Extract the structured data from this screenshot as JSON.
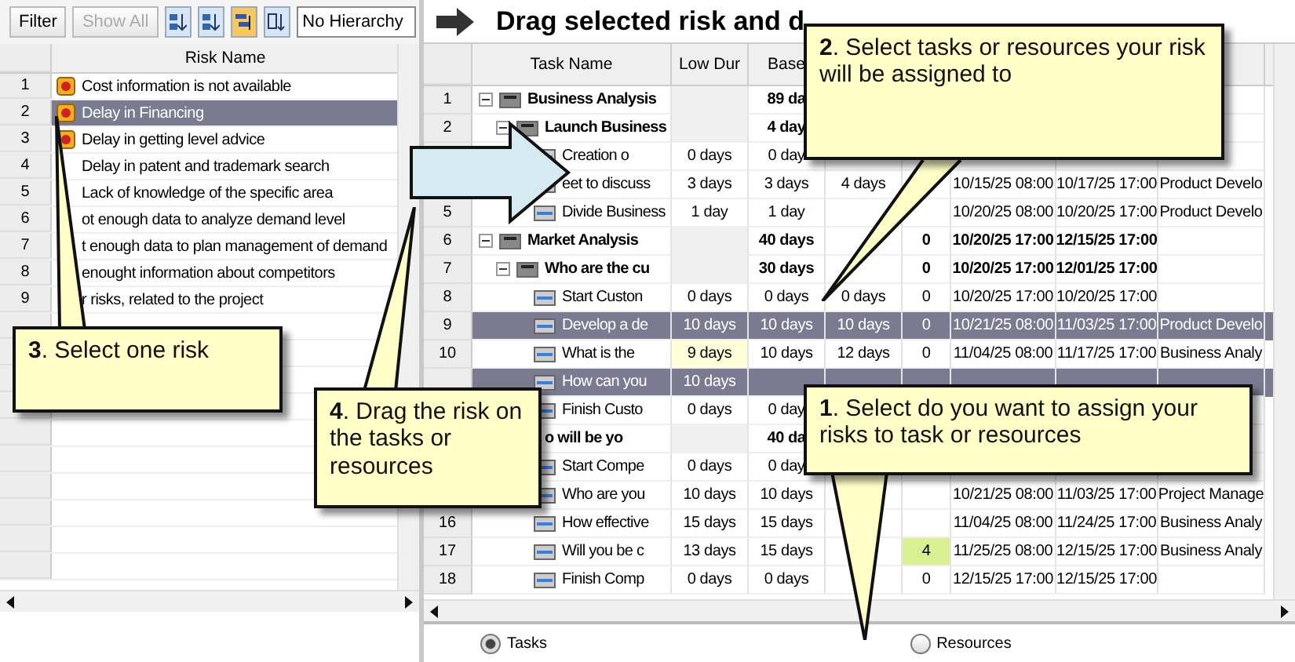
{
  "toolbar": {
    "filter": "Filter",
    "show_all": "Show All",
    "hierarchy": "No Hierarchy"
  },
  "risks": {
    "header": "Risk Name",
    "rows": [
      {
        "num": "1",
        "name": "Cost information is not available",
        "icon": true,
        "selected": false
      },
      {
        "num": "2",
        "name": "Delay in Financing",
        "icon": true,
        "selected": true
      },
      {
        "num": "3",
        "name": "Delay in getting level advice",
        "icon": true,
        "selected": false
      },
      {
        "num": "4",
        "name": "Delay in patent and trademark search",
        "icon": false,
        "selected": false
      },
      {
        "num": "5",
        "name": "Lack of knowledge of the specific area",
        "icon": false,
        "selected": false
      },
      {
        "num": "6",
        "name": "ot enough data to analyze demand level",
        "icon": false,
        "selected": false
      },
      {
        "num": "7",
        "name": "t enough data to plan management of demand",
        "icon": false,
        "selected": false
      },
      {
        "num": "8",
        "name": "enought information about competitors",
        "icon": false,
        "selected": false
      },
      {
        "num": "9",
        "name": "r risks, related to the project",
        "icon": false,
        "selected": false
      }
    ]
  },
  "title": "Drag selected risk and d",
  "columns": [
    "Task Name",
    "Low Dur",
    "Base",
    null,
    null,
    null,
    null,
    null
  ],
  "tasks": [
    {
      "num": "1",
      "name": "Business Analysis",
      "cells": [
        null,
        "89 da",
        null,
        null,
        null,
        null,
        null
      ],
      "selected": false,
      "expanded": true,
      "children": [
        {
          "num": "2",
          "name": "Launch Business",
          "cells": [
            null,
            "4 day",
            null,
            null,
            null,
            null,
            null
          ],
          "selected": false,
          "expanded": true,
          "children": [
            {
              "name": "Creation o",
              "cells": [
                "0 days",
                "0 day",
                null,
                null,
                null,
                null,
                null
              ],
              "selected": false
            },
            {
              "name": "eet to discuss",
              "cells": [
                "3 days",
                "3 days",
                "4 days",
                null,
                "10/15/25 08:00",
                "10/17/25 17:00",
                "Product Develo"
              ],
              "selected": false
            },
            {
              "num": "5",
              "name": "Divide Business",
              "cells": [
                "1 day",
                "1 day",
                null,
                null,
                "10/20/25 08:00",
                "10/20/25 17:00",
                "Product Develo"
              ],
              "selected": false
            }
          ]
        }
      ]
    },
    {
      "num": "6",
      "name": "Market Analysis",
      "cells": [
        null,
        "40 days",
        null,
        "0",
        "10/20/25 17:00",
        "12/15/25 17:00",
        null
      ],
      "selected": false,
      "expanded": true,
      "children": [
        {
          "num": "7",
          "name": "Who are the cu",
          "cells": [
            null,
            "30 days",
            null,
            "0",
            "10/20/25 17:00",
            "12/01/25 17:00",
            null
          ],
          "selected": false,
          "expanded": true,
          "children": [
            {
              "num": "8",
              "name": "Start Custon",
              "cells": [
                "0 days",
                "0 days",
                "0 days",
                "0",
                "10/20/25 17:00",
                "10/20/25 17:00",
                null
              ],
              "selected": false
            },
            {
              "num": "9",
              "name": "Develop a de",
              "cells": [
                "10 days",
                "10 days",
                "10 days",
                "0",
                "10/21/25 08:00",
                "11/03/25 17:00",
                "Product Develo"
              ],
              "selected": true
            },
            {
              "num": "10",
              "name": "What is the",
              "cells": [
                "9 days",
                "10 days",
                "12 days",
                "0",
                "11/04/25 08:00",
                "11/17/25 17:00",
                "Business Analy"
              ],
              "selected": false,
              "low_alert": true
            },
            {
              "name": "How can you",
              "cells": [
                "10 days",
                null,
                null,
                null,
                null,
                null,
                null
              ],
              "selected": true
            },
            {
              "name": "Finish Custo",
              "cells": [
                "0 days",
                "0 day",
                null,
                null,
                null,
                null,
                null
              ],
              "selected": false
            }
          ]
        },
        {
          "name": "o will be yo",
          "cells": [
            null,
            "40 da",
            null,
            null,
            null,
            null,
            null
          ],
          "selected": false,
          "children": [
            {
              "name": "Start Compe",
              "cells": [
                "0 days",
                "0 day",
                null,
                null,
                null,
                null,
                null
              ],
              "selected": false
            },
            {
              "name": "Who are you",
              "cells": [
                "10 days",
                "10 days",
                null,
                null,
                "10/21/25 08:00",
                "11/03/25 17:00",
                "Project Manage"
              ],
              "selected": false
            },
            {
              "num": "16",
              "name": "How effective",
              "cells": [
                "15 days",
                "15 days",
                null,
                null,
                "11/04/25 08:00",
                "11/24/25 17:00",
                "Business Analy"
              ],
              "selected": false
            },
            {
              "num": "17",
              "name": "Will you be c",
              "cells": [
                "13 days",
                "15 days",
                null,
                "4",
                "11/25/25 08:00",
                "12/15/25 17:00",
                "Business Analy"
              ],
              "selected": false,
              "count_alert": true
            },
            {
              "num": "18",
              "name": "Finish Comp",
              "cells": [
                "0 days",
                "0 days",
                null,
                "0",
                "12/15/25 17:00",
                "12/15/25 17:00",
                null
              ],
              "selected": false
            }
          ]
        }
      ]
    }
  ],
  "radios": [
    {
      "label": "Tasks",
      "selected": true
    },
    {
      "label": "Resources",
      "selected": false
    }
  ],
  "callouts": [
    {
      "text": "**2**. Select tasks or resources your risk will be assigned to"
    },
    {
      "text": "**3**. Select one risk"
    },
    {
      "text": "**4**. Drag the risk on the tasks or resources"
    },
    {
      "text": "**1**. Select do you want to assign your risks to task or resources"
    }
  ]
}
